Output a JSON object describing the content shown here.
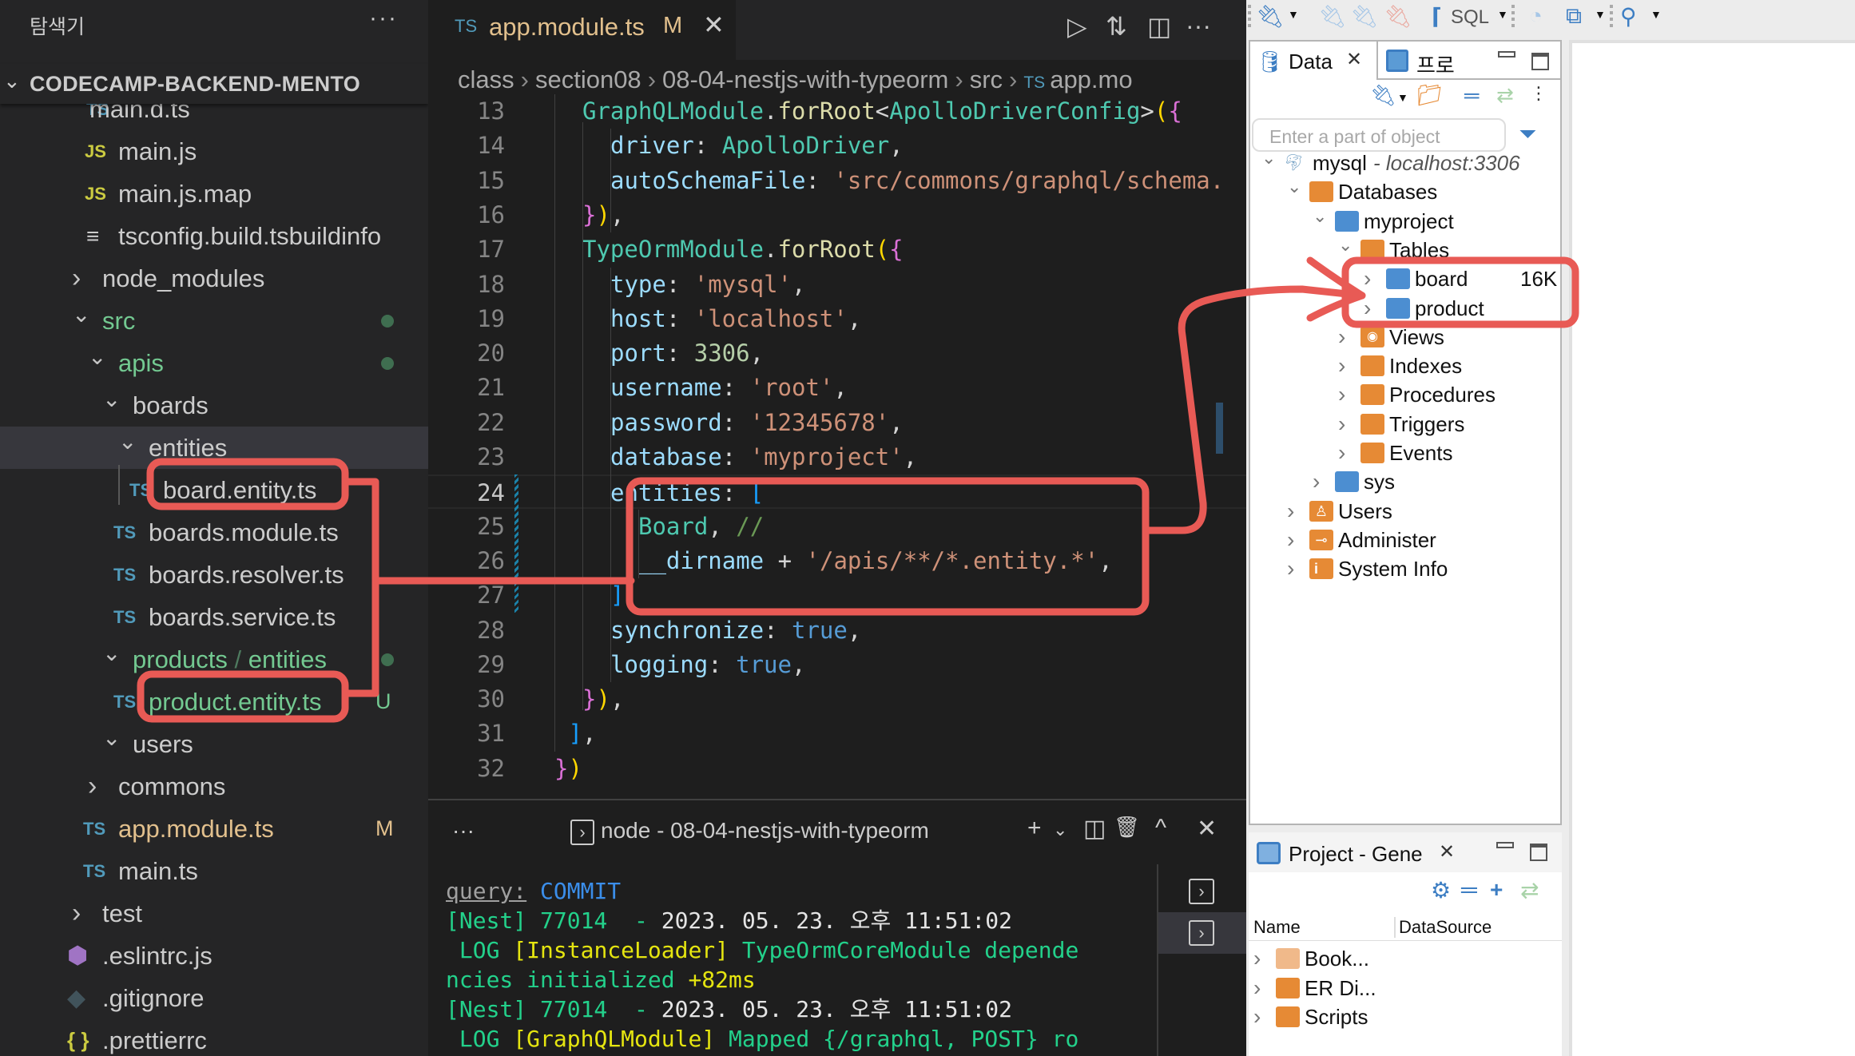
{
  "sidebar": {
    "title": "탐색기",
    "more": "···",
    "section": "CODECAMP-BACKEND-MENTO",
    "items": [
      {
        "icon": "TS",
        "label": "main.d.ts",
        "kind": "ts"
      },
      {
        "icon": "JS",
        "label": "main.js",
        "kind": "js"
      },
      {
        "icon": "JS",
        "label": "main.js.map",
        "kind": "js"
      },
      {
        "icon": "≡",
        "label": "tsconfig.build.tsbuildinfo",
        "kind": "text"
      },
      {
        "label": "node_modules",
        "kind": "folder-collapsed"
      },
      {
        "label": "src",
        "kind": "folder-open",
        "git": "modified-dot"
      },
      {
        "label": "apis",
        "kind": "folder-open",
        "git": "modified-dot"
      },
      {
        "label": "boards",
        "kind": "folder-open"
      },
      {
        "label": "entities",
        "kind": "folder-open",
        "selected": true
      },
      {
        "icon": "TS",
        "label": "board.entity.ts",
        "kind": "ts"
      },
      {
        "icon": "TS",
        "label": "boards.module.ts",
        "kind": "ts"
      },
      {
        "icon": "TS",
        "label": "boards.resolver.ts",
        "kind": "ts"
      },
      {
        "icon": "TS",
        "label": "boards.service.ts",
        "kind": "ts"
      },
      {
        "label": "products",
        "label2": "entities",
        "kind": "folder-open",
        "git": "modified-dot"
      },
      {
        "icon": "TS",
        "label": "product.entity.ts",
        "kind": "ts",
        "git": "U"
      },
      {
        "label": "users",
        "kind": "folder-open"
      },
      {
        "label": "commons",
        "kind": "folder-collapsed"
      },
      {
        "icon": "TS",
        "label": "app.module.ts",
        "kind": "ts",
        "git": "M"
      },
      {
        "icon": "TS",
        "label": "main.ts",
        "kind": "ts"
      },
      {
        "label": "test",
        "kind": "folder-collapsed"
      },
      {
        "label": ".eslintrc.js",
        "kind": "eslint"
      },
      {
        "label": ".gitignore",
        "kind": "git"
      },
      {
        "icon": "{ }",
        "label": ".prettierrc",
        "kind": "json"
      }
    ]
  },
  "editor": {
    "tab": {
      "icon": "TS",
      "name": "app.module.ts",
      "status": "M",
      "close": "✕"
    },
    "actions": [
      "▷",
      "⇅",
      "◫",
      "···"
    ],
    "breadcrumb": [
      "class",
      "section08",
      "08-04-nestjs-with-typeorm",
      "src",
      "app.mo"
    ],
    "breadcrumb_icon": "TS",
    "current_line": 24,
    "lines": [
      {
        "n": 13,
        "indent": 1,
        "tokens": [
          [
            "GraphQLModule",
            "cls"
          ],
          [
            ".",
            "p"
          ],
          [
            "forRoot",
            "fn"
          ],
          [
            "<",
            "p"
          ],
          [
            "ApolloDriverConfig",
            "cls"
          ],
          [
            ">",
            "p"
          ],
          [
            "(",
            "b2"
          ],
          [
            "{",
            "b1"
          ]
        ]
      },
      {
        "n": 14,
        "indent": 2,
        "tokens": [
          [
            "driver",
            "prop"
          ],
          [
            ": ",
            "p"
          ],
          [
            "ApolloDriver",
            "cls"
          ],
          [
            ",",
            "p"
          ]
        ]
      },
      {
        "n": 15,
        "indent": 2,
        "tokens": [
          [
            "autoSchemaFile",
            "prop"
          ],
          [
            ": ",
            "p"
          ],
          [
            "'src/commons/graphql/schema.",
            "str"
          ]
        ]
      },
      {
        "n": 16,
        "indent": 1,
        "tokens": [
          [
            "}",
            "b1"
          ],
          [
            ")",
            "b2"
          ],
          [
            ",",
            "p"
          ]
        ]
      },
      {
        "n": 17,
        "indent": 1,
        "tokens": [
          [
            "TypeOrmModule",
            "cls"
          ],
          [
            ".",
            "p"
          ],
          [
            "forRoot",
            "fn"
          ],
          [
            "(",
            "b2"
          ],
          [
            "{",
            "b1"
          ]
        ]
      },
      {
        "n": 18,
        "indent": 2,
        "tokens": [
          [
            "type",
            "prop"
          ],
          [
            ": ",
            "p"
          ],
          [
            "'mysql'",
            "str"
          ],
          [
            ",",
            "p"
          ]
        ]
      },
      {
        "n": 19,
        "indent": 2,
        "tokens": [
          [
            "host",
            "prop"
          ],
          [
            ": ",
            "p"
          ],
          [
            "'localhost'",
            "str"
          ],
          [
            ",",
            "p"
          ]
        ]
      },
      {
        "n": 20,
        "indent": 2,
        "tokens": [
          [
            "port",
            "prop"
          ],
          [
            ": ",
            "p"
          ],
          [
            "3306",
            "num"
          ],
          [
            ",",
            "p"
          ]
        ]
      },
      {
        "n": 21,
        "indent": 2,
        "tokens": [
          [
            "username",
            "prop"
          ],
          [
            ": ",
            "p"
          ],
          [
            "'root'",
            "str"
          ],
          [
            ",",
            "p"
          ]
        ]
      },
      {
        "n": 22,
        "indent": 2,
        "tokens": [
          [
            "password",
            "prop"
          ],
          [
            ": ",
            "p"
          ],
          [
            "'12345678'",
            "str"
          ],
          [
            ",",
            "p"
          ]
        ]
      },
      {
        "n": 23,
        "indent": 2,
        "tokens": [
          [
            "database",
            "prop"
          ],
          [
            ": ",
            "p"
          ],
          [
            "'myproject'",
            "str"
          ],
          [
            ",",
            "p"
          ]
        ]
      },
      {
        "n": 24,
        "indent": 2,
        "tokens": [
          [
            "entities",
            "prop"
          ],
          [
            ": ",
            "p"
          ],
          [
            "[",
            "b3"
          ]
        ]
      },
      {
        "n": 25,
        "indent": 3,
        "tokens": [
          [
            "Board",
            "cls"
          ],
          [
            ", ",
            "p"
          ],
          [
            "//",
            "com"
          ]
        ]
      },
      {
        "n": 26,
        "indent": 3,
        "tokens": [
          [
            "__dirname",
            "prop"
          ],
          [
            " + ",
            "p"
          ],
          [
            "'/apis/**/*.entity.*'",
            "str"
          ],
          [
            ",",
            "p"
          ]
        ]
      },
      {
        "n": 27,
        "indent": 2,
        "tokens": [
          [
            "]",
            "b3"
          ],
          [
            ",",
            "p"
          ]
        ]
      },
      {
        "n": 28,
        "indent": 2,
        "tokens": [
          [
            "synchronize",
            "prop"
          ],
          [
            ": ",
            "p"
          ],
          [
            "true",
            "kw"
          ],
          [
            ",",
            "p"
          ]
        ]
      },
      {
        "n": 29,
        "indent": 2,
        "tokens": [
          [
            "logging",
            "prop"
          ],
          [
            ": ",
            "p"
          ],
          [
            "true",
            "kw"
          ],
          [
            ",",
            "p"
          ]
        ]
      },
      {
        "n": 30,
        "indent": 1,
        "tokens": [
          [
            "}",
            "b1"
          ],
          [
            ")",
            "b2"
          ],
          [
            ",",
            "p"
          ]
        ]
      },
      {
        "n": 31,
        "indent": 0.5,
        "tokens": [
          [
            "]",
            "b3"
          ],
          [
            ",",
            "p"
          ]
        ]
      },
      {
        "n": 32,
        "indent": 0,
        "tokens": [
          [
            "}",
            "b1"
          ],
          [
            ")",
            "b2"
          ]
        ]
      }
    ]
  },
  "terminal": {
    "more": "···",
    "name": "node - 08-04-nestjs-with-typeorm",
    "actions": [
      "+",
      "⌄",
      "◫",
      "🗑",
      "^",
      "✕"
    ],
    "lines": [
      [
        [
          "query:",
          "dim"
        ],
        [
          " ",
          "w"
        ],
        [
          "COMMIT",
          "blue"
        ]
      ],
      [
        [
          "[Nest] 77014  - ",
          "green"
        ],
        [
          "2023. 05. 23. 오후 11:51:02",
          "white"
        ]
      ],
      [
        [
          " LOG ",
          "green"
        ],
        [
          "[InstanceLoader]",
          "yel"
        ],
        [
          " TypeOrmCoreModule depende",
          "green"
        ]
      ],
      [
        [
          "ncies initialized ",
          "green"
        ],
        [
          "+82ms",
          "yel"
        ]
      ],
      [
        [
          "[Nest] 77014  - ",
          "green"
        ],
        [
          "2023. 05. 23. 오후 11:51:02",
          "white"
        ]
      ],
      [
        [
          " LOG ",
          "green"
        ],
        [
          "[GraphQLModule]",
          "yel"
        ],
        [
          " Mapped {/graphql, POST} ro",
          "green"
        ]
      ]
    ],
    "instances": 2,
    "selected_instance": 2
  },
  "dbeaver": {
    "toolbar": {
      "sql_label": "SQL"
    },
    "data_tab": {
      "label": "Data",
      "close": "✕"
    },
    "project_tab_short": "프로",
    "filter_placeholder": "Enter a part of object",
    "tree": [
      {
        "level": 0,
        "expanded": true,
        "icon": "mysql",
        "label": "mysql",
        "extra": " - localhost:3306"
      },
      {
        "level": 1,
        "expanded": true,
        "icon": "databases-folder",
        "label": "Databases"
      },
      {
        "level": 2,
        "expanded": true,
        "icon": "database",
        "label": "myproject"
      },
      {
        "level": 3,
        "expanded": true,
        "icon": "tables-folder",
        "label": "Tables"
      },
      {
        "level": 4,
        "expanded": false,
        "icon": "table",
        "label": "board",
        "size": "16K"
      },
      {
        "level": 4,
        "expanded": false,
        "icon": "table",
        "label": "product"
      },
      {
        "level": 3,
        "expanded": false,
        "icon": "views-folder",
        "label": "Views"
      },
      {
        "level": 3,
        "expanded": false,
        "icon": "folder",
        "label": "Indexes"
      },
      {
        "level": 3,
        "expanded": false,
        "icon": "folder",
        "label": "Procedures"
      },
      {
        "level": 3,
        "expanded": false,
        "icon": "folder",
        "label": "Triggers"
      },
      {
        "level": 3,
        "expanded": false,
        "icon": "folder",
        "label": "Events"
      },
      {
        "level": 2,
        "expanded": false,
        "icon": "database",
        "label": "sys"
      },
      {
        "level": 1,
        "expanded": false,
        "icon": "users-folder",
        "label": "Users"
      },
      {
        "level": 1,
        "expanded": false,
        "icon": "admin-folder",
        "label": "Administer"
      },
      {
        "level": 1,
        "expanded": false,
        "icon": "info-folder",
        "label": "System Info"
      }
    ],
    "project": {
      "tab_label": "Project - Gene",
      "close": "✕",
      "columns": [
        "Name",
        "DataSource"
      ],
      "items": [
        {
          "icon": "bookmarks-folder",
          "label": "Book..."
        },
        {
          "icon": "er-folder",
          "label": "ER Di..."
        },
        {
          "icon": "scripts-folder",
          "label": "Scripts"
        }
      ]
    }
  },
  "colors": {
    "annotation": "#e85a55",
    "ts_icon": "#519aba",
    "git_untracked": "#73c991",
    "git_modified": "#e2c08d",
    "dbeaver_blue": "#3d7ec3",
    "dbeaver_orange": "#e68a35"
  }
}
